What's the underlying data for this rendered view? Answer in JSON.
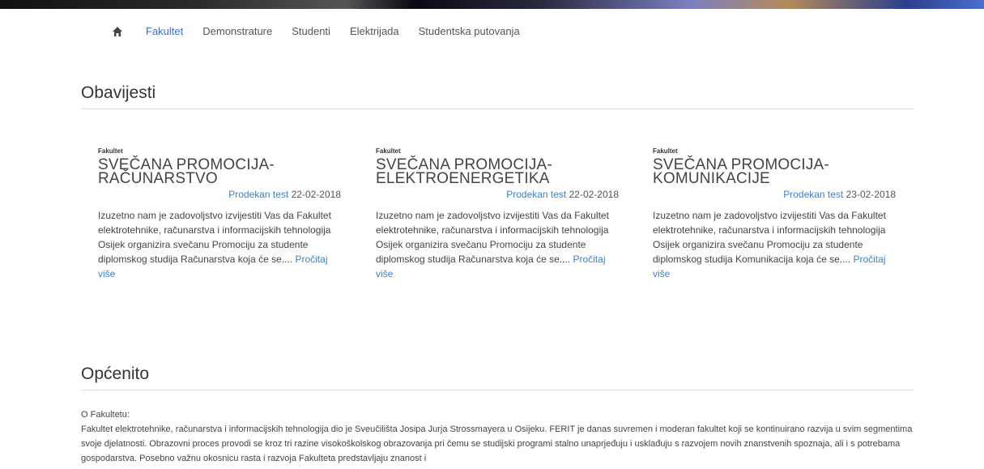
{
  "nav": {
    "items": [
      {
        "label": "Fakultet",
        "active": true
      },
      {
        "label": "Demonstrature",
        "active": false
      },
      {
        "label": "Studenti",
        "active": false
      },
      {
        "label": "Elektrijada",
        "active": false
      },
      {
        "label": "Studentska putovanja",
        "active": false
      }
    ]
  },
  "sections": {
    "news_title": "Obavijesti",
    "general_title": "Općenito"
  },
  "news": [
    {
      "category": "Fakultet",
      "title_line1": "SVEČANA PROMOCIJA-",
      "title_line2": "RAČUNARSTVO",
      "author": "Prodekan test",
      "date": "22-02-2018",
      "excerpt": "Izuzetno nam je zadovoljstvo izvijestiti Vas da Fakultet elektrotehnike, računarstva i informacijskih tehnologija Osijek organizira svečanu Promociju za studente diplomskog studija Računarstva koja će se....",
      "read_more": "Pročitaj više"
    },
    {
      "category": "Fakultet",
      "title_line1": "SVEČANA PROMOCIJA-",
      "title_line2": "ELEKTROENERGETIKA",
      "author": "Prodekan test",
      "date": "22-02-2018",
      "excerpt": "Izuzetno nam je zadovoljstvo izvijestiti Vas da Fakultet elektrotehnike, računarstva i informacijskih tehnologija Osijek organizira svečanu Promociju za studente diplomskog studija Računarstva koja će se....",
      "read_more": "Pročitaj više"
    },
    {
      "category": "Fakultet",
      "title_line1": "SVEČANA PROMOCIJA-",
      "title_line2": "KOMUNIKACIJE",
      "author": "Prodekan test",
      "date": "23-02-2018",
      "excerpt": "Izuzetno nam je zadovoljstvo izvijestiti Vas da Fakultet elektrotehnike, računarstva i informacijskih tehnologija Osijek organizira svečanu Promociju za studente diplomskog studija Komunikacija koja će se....",
      "read_more": "Pročitaj više"
    }
  ],
  "about": {
    "heading": "O Fakultetu:",
    "body": "Fakultet elektrotehnike, računarstva i informacijskih tehnologija dio je Sveučilišta Josipa Jurja Strossmayera u Osijeku. FERIT je danas suvremen i moderan fakultet koji se kontinuirano razvija u svim segmentima svoje djelatnosti. Obrazovni proces provodi se kroz tri razine visokoškolskog obrazovanja pri čemu se studijski programi stalno unaprjeđuju i usklađuju s razvojem novih znanstvenih spoznaja, ali i s potrebama gospodarstva. Posebno važnu okosnicu rasta i razvoja Fakulteta predstavljaju znanost i"
  }
}
